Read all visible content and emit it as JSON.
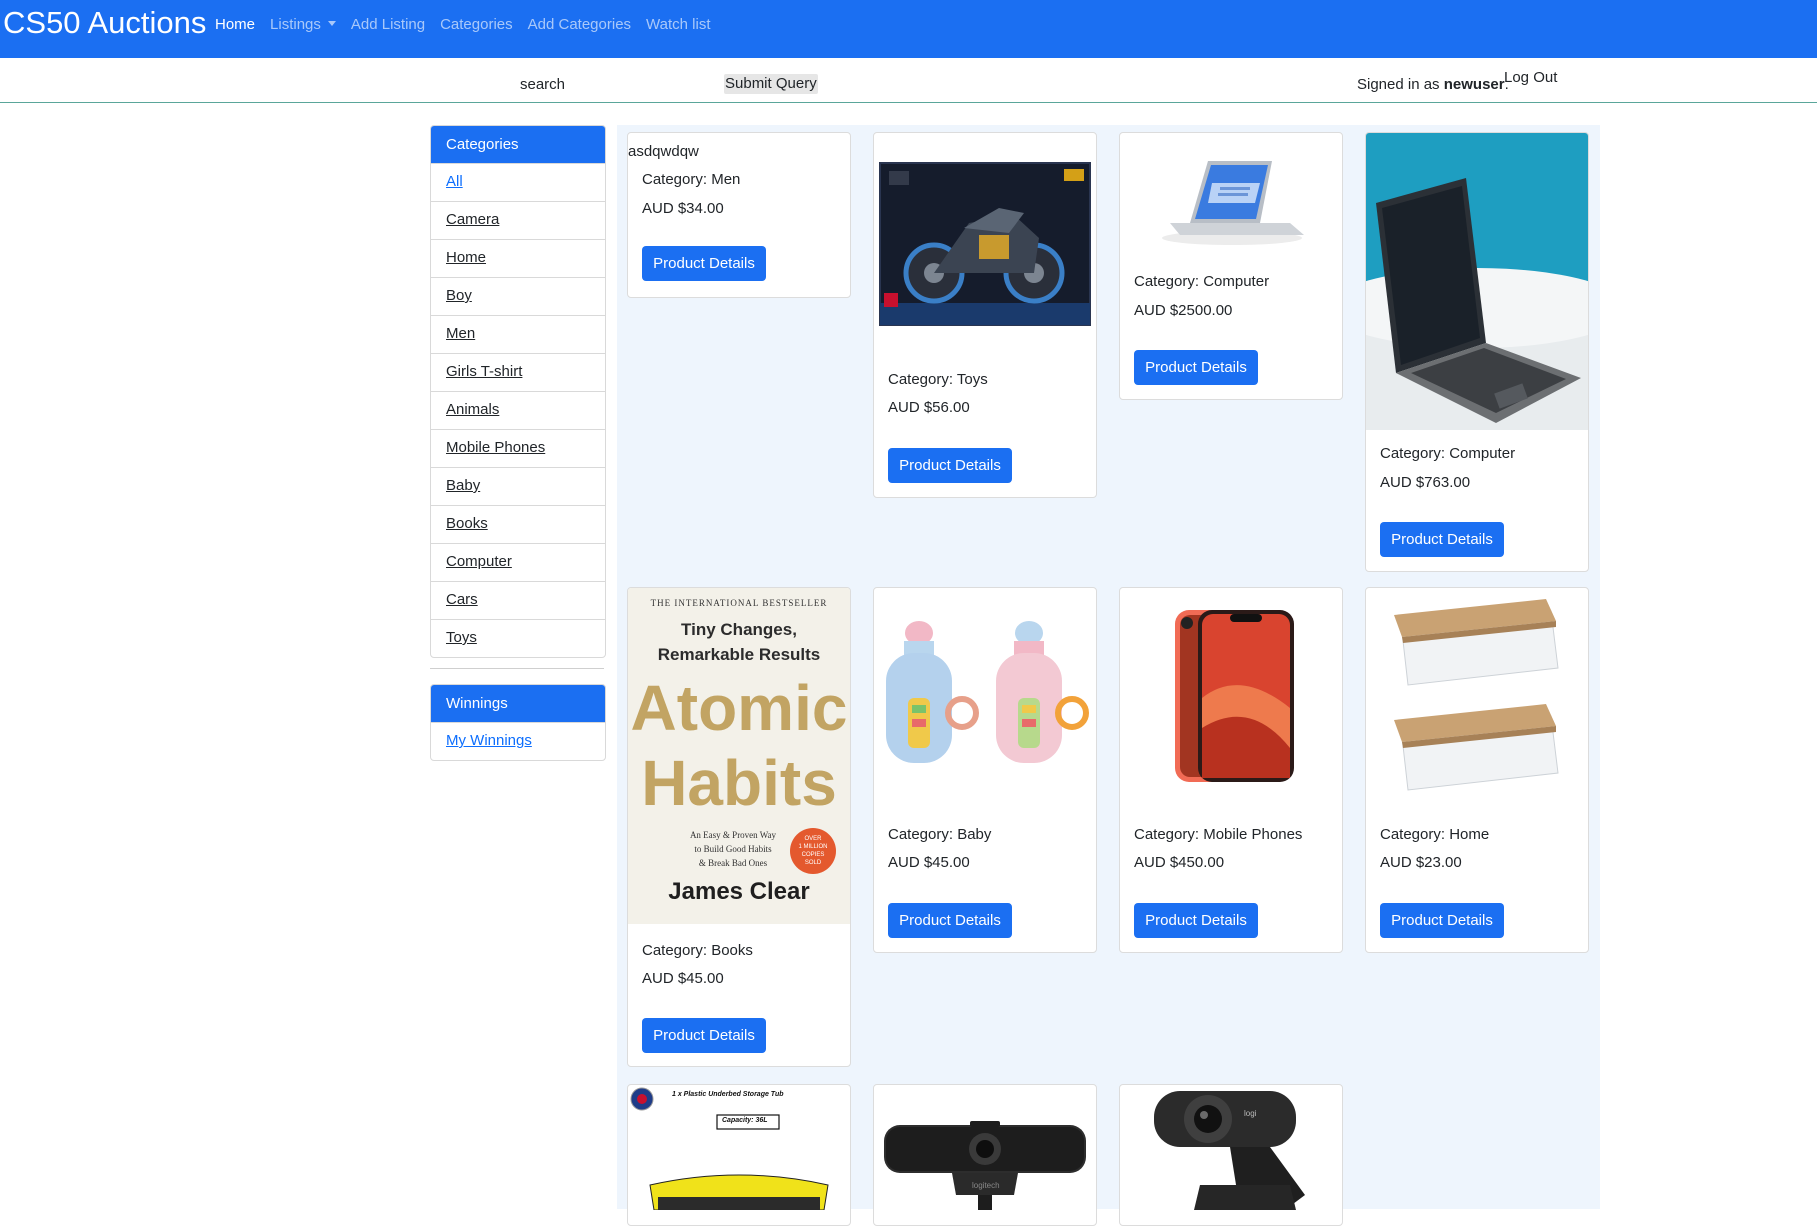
{
  "navbar": {
    "brand": "CS50 Auctions",
    "links": [
      {
        "label": "Home"
      },
      {
        "label": "Listings"
      },
      {
        "label": "Add Listing"
      },
      {
        "label": "Categories"
      },
      {
        "label": "Add Categories"
      },
      {
        "label": "Watch list"
      }
    ]
  },
  "searchbar": {
    "placeholder": "search",
    "submit_label": "Submit Query",
    "signed_in_prefix": "Signed in as ",
    "username": "newuser",
    "signed_in_suffix": ".",
    "logout": "Log Out"
  },
  "sidebar": {
    "categories_header": "Categories",
    "categories": [
      "All",
      "Camera",
      "Home",
      "Boy",
      "Men",
      "Girls T-shirt",
      "Animals",
      "Mobile Phones",
      "Baby",
      "Books",
      "Computer",
      "Cars",
      "Toys"
    ],
    "winnings_header": "Winnings",
    "winnings_link": "My Winnings"
  },
  "products": [
    {
      "title": "asdqwdqw",
      "category": "Category: Men",
      "price": "AUD $34.00",
      "button": "Product Details"
    },
    {
      "category": "Category: Toys",
      "price": "AUD $56.00",
      "button": "Product Details"
    },
    {
      "category": "Category: Computer",
      "price": "AUD $2500.00",
      "button": "Product Details"
    },
    {
      "category": "Category: Computer",
      "price": "AUD $763.00",
      "button": "Product Details"
    },
    {
      "category": "Category: Books",
      "price": "AUD $45.00",
      "button": "Product Details",
      "book": {
        "top": "THE INTERNATIONAL BESTSELLER",
        "sub1": "Tiny Changes,",
        "sub2": "Remarkable Results",
        "title1": "Atomic",
        "title2": "Habits",
        "tag1": "An Easy & Proven Way",
        "tag2": "to Build Good Habits",
        "tag3": "& Break Bad Ones",
        "badge1": "OVER",
        "badge2": "1 MILLION",
        "badge3": "COPIES",
        "badge4": "SOLD",
        "author": "James Clear"
      }
    },
    {
      "category": "Category: Baby",
      "price": "AUD $45.00",
      "button": "Product Details"
    },
    {
      "category": "Category: Mobile Phones",
      "price": "AUD $450.00",
      "button": "Product Details"
    },
    {
      "category": "Category: Home",
      "price": "AUD $23.00",
      "button": "Product Details"
    }
  ],
  "partial_products": [
    {
      "caption": "1 x Plastic Underbed Storage Tub",
      "capacity": "Capacity: 36L"
    },
    {
      "logo": "logitech"
    },
    {
      "logo": "logi"
    }
  ],
  "colors": {
    "primary": "#1b6ff2",
    "main_bg": "#eef5fd"
  }
}
